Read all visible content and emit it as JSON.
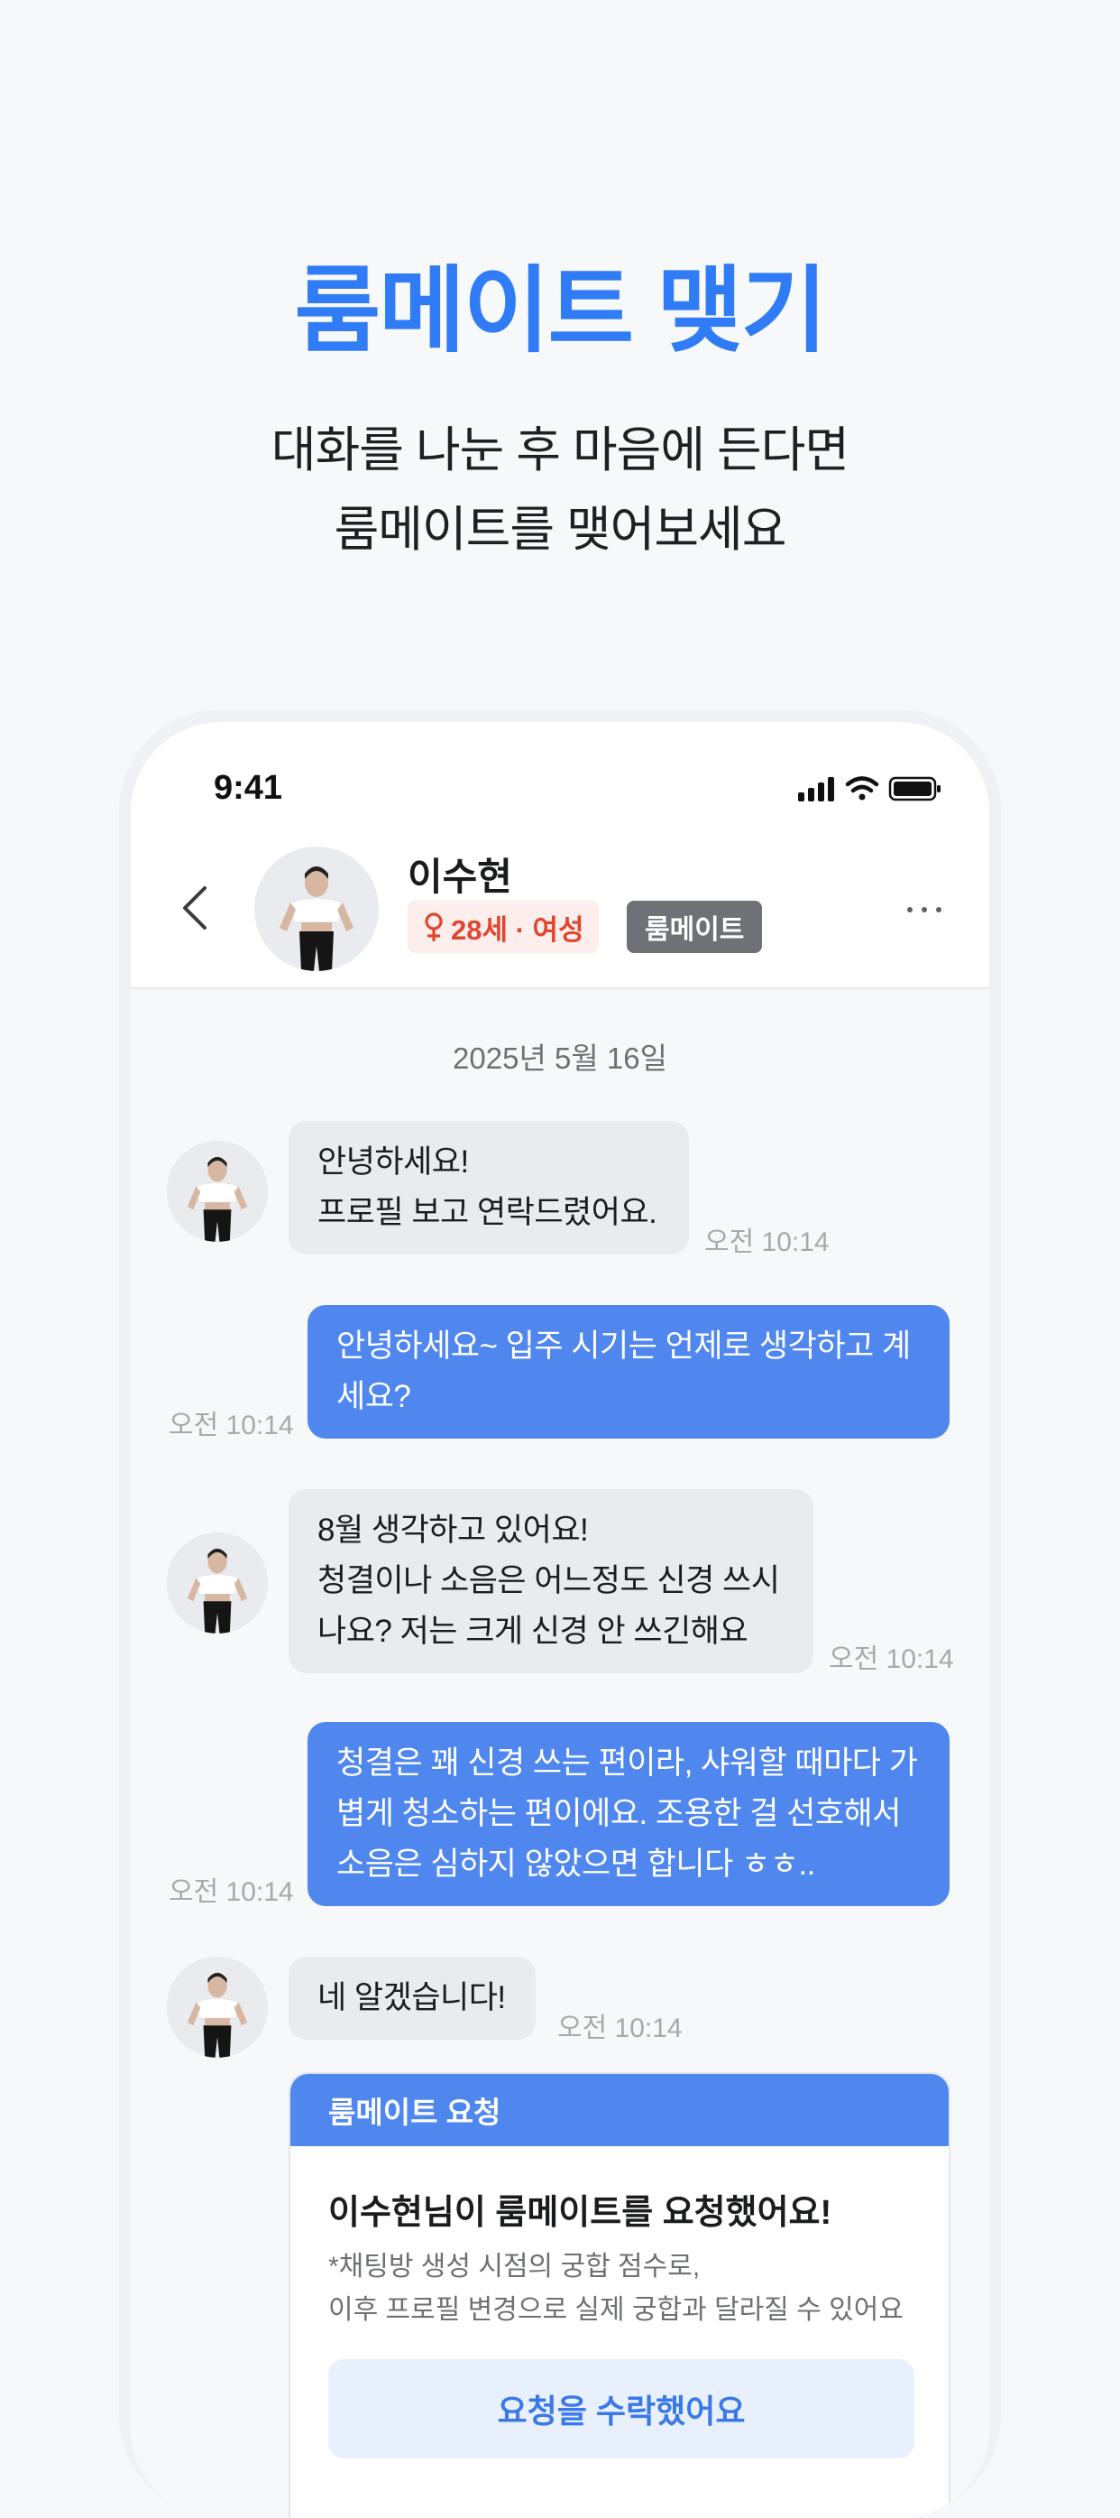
{
  "hero": {
    "title": "룸메이트 맺기",
    "subtitle_lines": [
      "대화를 나눈 후 마음에 든다면",
      "룸메이트를 맺어보세요"
    ]
  },
  "status_bar": {
    "time": "9:41"
  },
  "chat_header": {
    "name": "이수현",
    "gender_badge": "28세 · 여성",
    "role_badge": "룸메이트"
  },
  "date_separator": "2025년 5월 16일",
  "messages": [
    {
      "from": "them",
      "lines": [
        "안녕하세요!",
        "프로필 보고 연락드렸어요."
      ],
      "time": "오전 10:14"
    },
    {
      "from": "me",
      "lines": [
        "안녕하세요~ 입주 시기는 언제로 생각하고 계",
        "세요?"
      ],
      "time": "오전 10:14"
    },
    {
      "from": "them",
      "lines": [
        "8월 생각하고 있어요!",
        "청결이나 소음은 어느정도 신경 쓰시",
        "나요? 저는 크게 신경 안 쓰긴해요"
      ],
      "time": "오전 10:14"
    },
    {
      "from": "me",
      "lines": [
        "청결은 꽤 신경 쓰는 편이라, 샤워할 때마다 가",
        "볍게 청소하는 편이에요. 조용한 걸 선호해서",
        "소음은 심하지 않았으면 합니다 ㅎㅎ.."
      ],
      "time": "오전 10:14"
    },
    {
      "from": "them",
      "lines": [
        "네 알겠습니다!"
      ],
      "time": "오전 10:14"
    }
  ],
  "request_card": {
    "header": "룸메이트 요청",
    "title": "이수현님이 룸메이트를 요청했어요!",
    "note_lines": [
      "*채팅방 생성 시점의 궁합 점수로,",
      "이후 프로필 변경으로 실제 궁합과 달라질 수 있어요"
    ],
    "button": "요청을 수락했어요"
  },
  "colors": {
    "accent": "#2f7cf6",
    "bubble_out": "#4f87ef",
    "bubble_in": "#eaebee",
    "gender_text": "#e0452f"
  }
}
